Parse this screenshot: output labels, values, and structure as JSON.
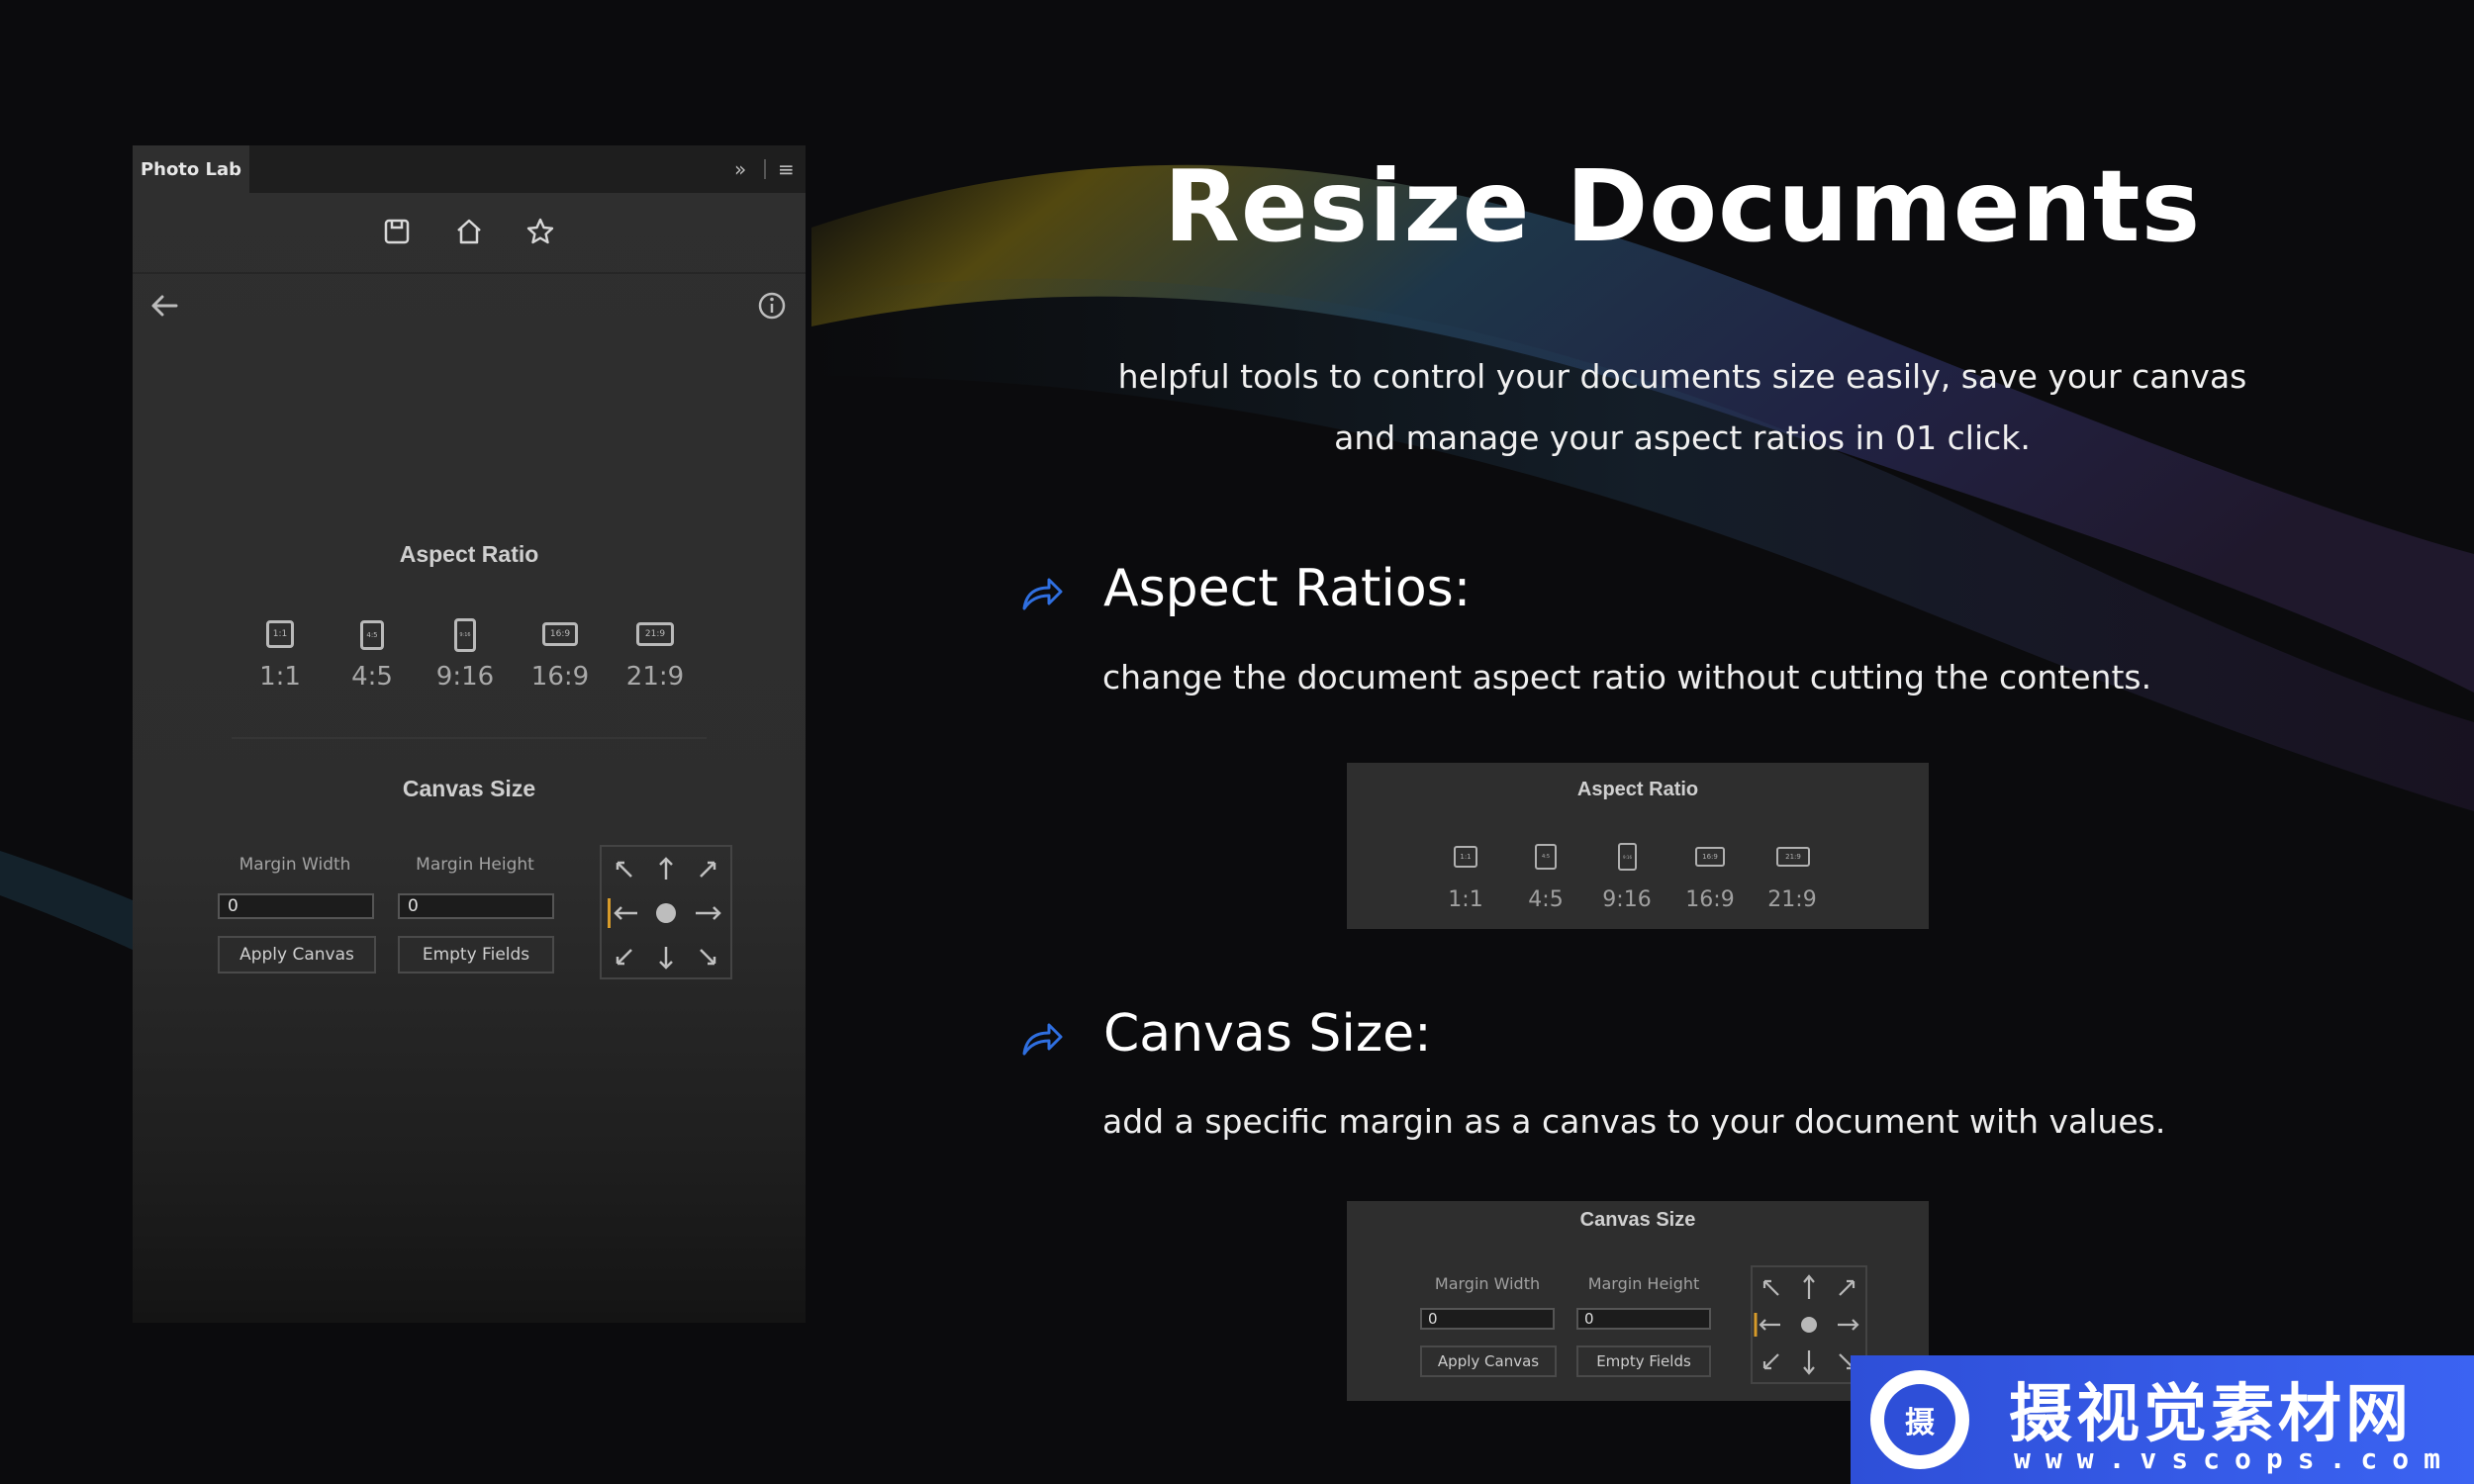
{
  "panel": {
    "tab_label": "Photo Lab",
    "collapse_glyph": "»",
    "menu_glyph": "≡",
    "toolbar_icons": [
      "save-icon",
      "home-icon",
      "star-icon"
    ],
    "back_icon": "arrow-left-icon",
    "info_icon": "info-icon",
    "aspect_ratio": {
      "title": "Aspect Ratio",
      "items": [
        {
          "label": "1:1",
          "badge": "1:1"
        },
        {
          "label": "4:5",
          "badge": "4:5"
        },
        {
          "label": "9:16",
          "badge": "9:16"
        },
        {
          "label": "16:9",
          "badge": "16:9"
        },
        {
          "label": "21:9",
          "badge": "21:9"
        }
      ]
    },
    "canvas_size": {
      "title": "Canvas Size",
      "margin_width_label": "Margin Width",
      "margin_height_label": "Margin Height",
      "margin_width_value": "0",
      "margin_height_value": "0",
      "apply_label": "Apply Canvas",
      "empty_label": "Empty Fields",
      "anchor_selected": "center"
    }
  },
  "hero": {
    "title": "Resize Documents",
    "subtitle_line1": "helpful tools to control your documents size easily, save your canvas",
    "subtitle_line2": "and manage your aspect ratios in 01 click."
  },
  "features": [
    {
      "title": "Aspect Ratios:",
      "desc": "change the document aspect ratio without cutting the contents."
    },
    {
      "title": "Canvas Size:",
      "desc": "add a specific margin as a canvas to your document with values."
    }
  ],
  "watermark": {
    "logo_char": "摄",
    "name": "摄视觉素材网",
    "url": "www.vscops.com"
  },
  "colors": {
    "accent_arrow": "#2f6fe0",
    "anchor_highlight": "#d79b2a",
    "watermark_blue": "#2e4fd8"
  }
}
